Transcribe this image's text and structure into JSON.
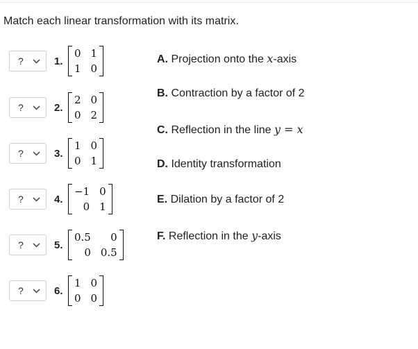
{
  "prompt": "Match each linear transformation with its matrix.",
  "select_placeholder": "?",
  "items": [
    {
      "number": "1.",
      "matrix": [
        [
          "0",
          "1"
        ],
        [
          "1",
          "0"
        ]
      ]
    },
    {
      "number": "2.",
      "matrix": [
        [
          "2",
          "0"
        ],
        [
          "0",
          "2"
        ]
      ]
    },
    {
      "number": "3.",
      "matrix": [
        [
          "1",
          "0"
        ],
        [
          "0",
          "1"
        ]
      ]
    },
    {
      "number": "4.",
      "matrix": [
        [
          "−1",
          "0"
        ],
        [
          "0",
          "1"
        ]
      ]
    },
    {
      "number": "5.",
      "matrix": [
        [
          "0.5",
          "0"
        ],
        [
          "0",
          "0.5"
        ]
      ]
    },
    {
      "number": "6.",
      "matrix": [
        [
          "1",
          "0"
        ],
        [
          "0",
          "0"
        ]
      ]
    }
  ],
  "answers": [
    {
      "letter": "A.",
      "text": "Projection onto the ",
      "math": "x",
      "suffix": "-axis"
    },
    {
      "letter": "B.",
      "text": "Contraction by a factor of 2",
      "math": "",
      "suffix": ""
    },
    {
      "letter": "C.",
      "text": "Reflection in the line ",
      "math": "y = x",
      "suffix": ""
    },
    {
      "letter": "D.",
      "text": "Identity transformation",
      "math": "",
      "suffix": ""
    },
    {
      "letter": "E.",
      "text": "Dilation by a factor of 2",
      "math": "",
      "suffix": ""
    },
    {
      "letter": "F.",
      "text": "Reflection in the ",
      "math": "y",
      "suffix": "-axis"
    }
  ]
}
